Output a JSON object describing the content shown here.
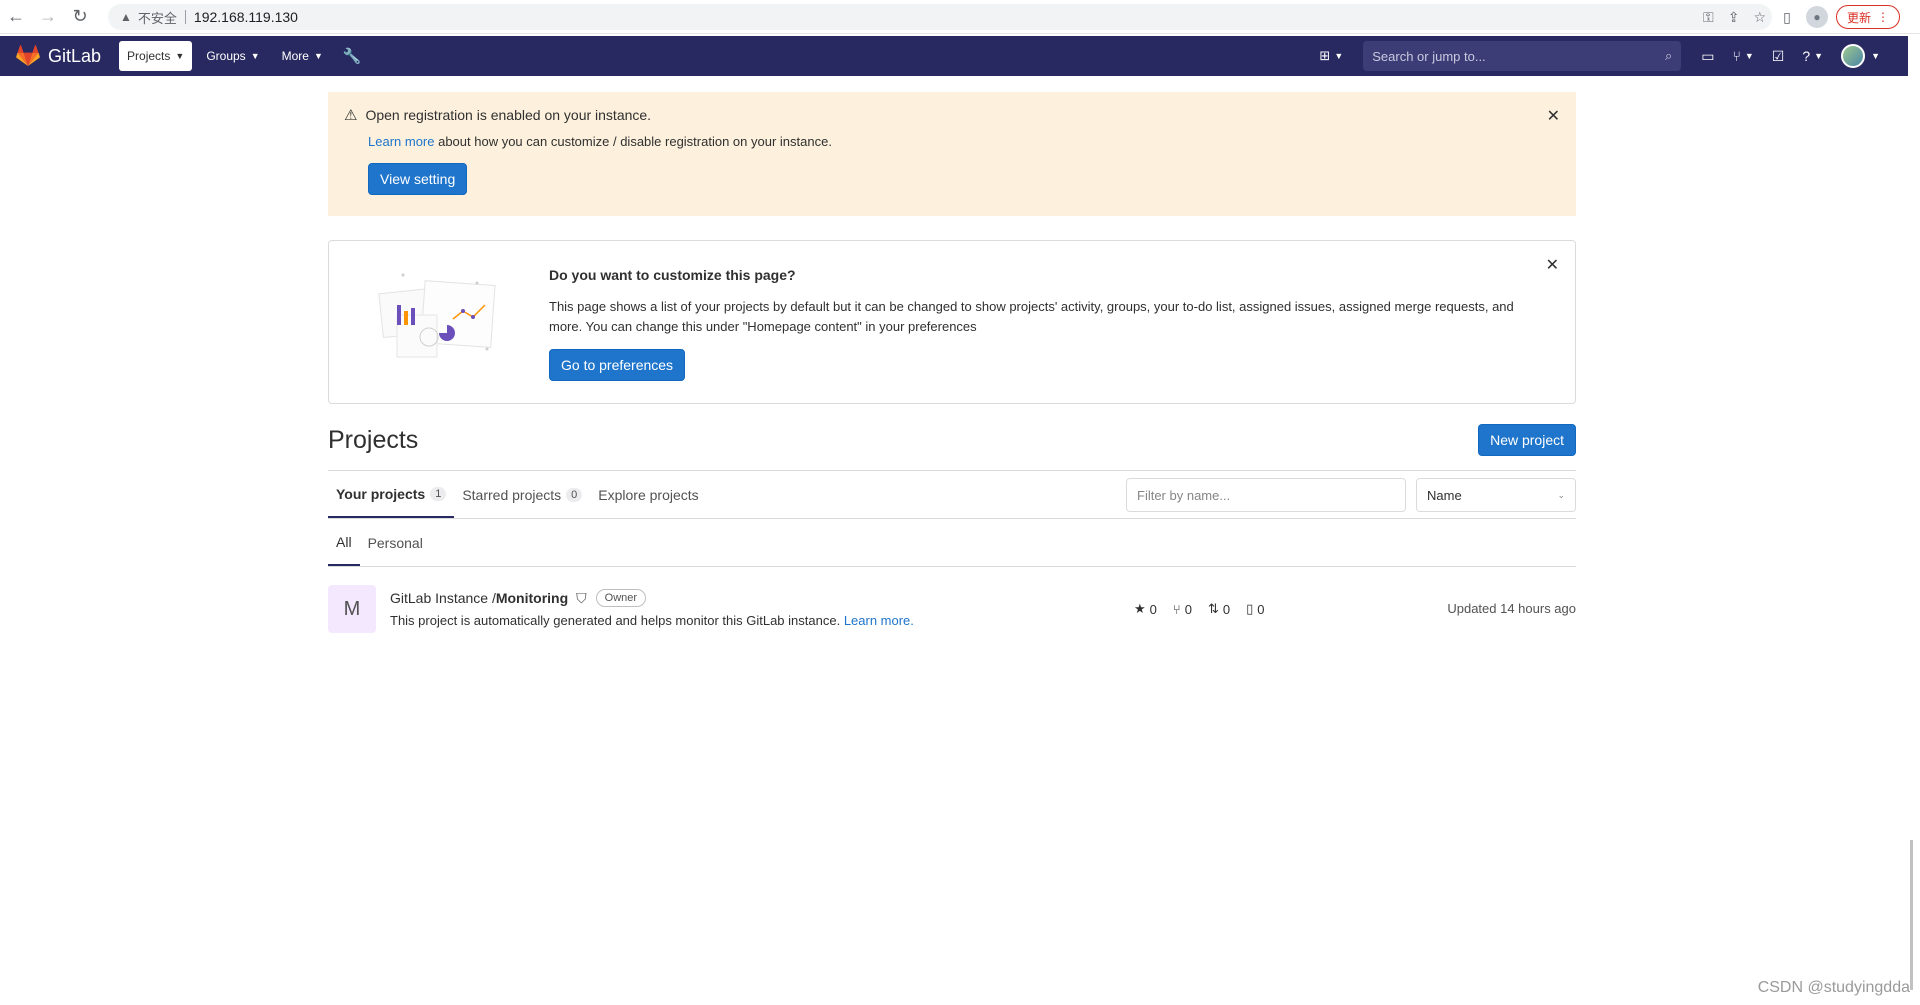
{
  "browser": {
    "security_label": "不安全",
    "url": "192.168.119.130",
    "update_label": "更新"
  },
  "navbar": {
    "brand": "GitLab",
    "projects_label": "Projects",
    "groups_label": "Groups",
    "more_label": "More",
    "search_placeholder": "Search or jump to..."
  },
  "registration_alert": {
    "title": "Open registration is enabled on your instance.",
    "link_text": "Learn more",
    "body_text": " about how you can customize / disable registration on your instance.",
    "button": "View setting"
  },
  "customize_callout": {
    "heading": "Do you want to customize this page?",
    "description": "This page shows a list of your projects by default but it can be changed to show projects' activity, groups, your to-do list, assigned issues, assigned merge requests, and more. You can change this under \"Homepage content\" in your preferences",
    "button": "Go to preferences"
  },
  "projects": {
    "title": "Projects",
    "new_button": "New project",
    "tabs": [
      {
        "label": "Your projects",
        "count": "1"
      },
      {
        "label": "Starred projects",
        "count": "0"
      },
      {
        "label": "Explore projects"
      }
    ],
    "filter_placeholder": "Filter by name...",
    "sort_value": "Name",
    "subtabs": [
      "All",
      "Personal"
    ],
    "items": [
      {
        "avatar_letter": "M",
        "namespace": "GitLab Instance / ",
        "name": "Monitoring",
        "role": "Owner",
        "description": "This project is automatically generated and helps monitor this GitLab instance.",
        "description_link": "Learn more.",
        "stars": "0",
        "forks": "0",
        "merge_requests": "0",
        "issues": "0",
        "updated": "Updated 14 hours ago"
      }
    ]
  },
  "watermark": "CSDN @studyingdda",
  "icons": {
    "warning": "warning-icon",
    "close": "close-icon",
    "shield": "shield-icon",
    "star": "star-icon",
    "fork": "fork-icon",
    "merge_request": "merge-request-icon",
    "issue": "issue-icon"
  }
}
